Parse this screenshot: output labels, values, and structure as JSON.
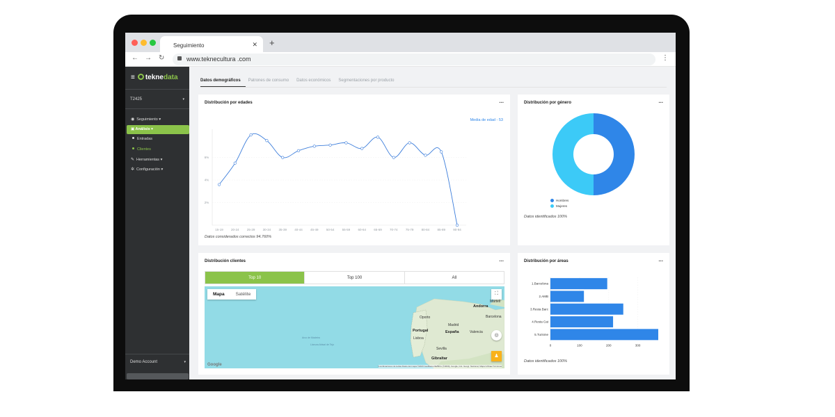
{
  "browser": {
    "tab_title": "Seguimiento",
    "tab_close": "✕",
    "new_tab": "+",
    "url": "www.teknecultura .com"
  },
  "sidebar": {
    "brand_prefix": "tekne",
    "brand_accent": "data",
    "project_select": "T2425",
    "menu": {
      "seguimiento": "Seguimiento ▾",
      "analisis": "Análisis ▾",
      "entradas": "Entradas",
      "clientes": "Clientes",
      "herramientas": "Herramientas ▾",
      "configuracion": "Configuración ▾"
    },
    "account": "Demo Account"
  },
  "tabs": [
    "Datos demográficos",
    "Patrones de consumo",
    "Datos económicos",
    "Segmentaciones por producto"
  ],
  "age_card": {
    "title": "Distribución por edades",
    "menu": "...",
    "average_label": "Media de edad - 53",
    "footnote": "Datos considerados correctos 94.760%"
  },
  "gender_card": {
    "title": "Distribución por género",
    "menu": "...",
    "footnote": "Datos identificados 100%"
  },
  "clients_card": {
    "title": "Distribución clientes",
    "menu": "...",
    "segments": [
      "Top 10",
      "Top 100",
      "All"
    ],
    "map_types": [
      "Mapa",
      "Satélite"
    ],
    "map_labels": {
      "andorra": "Andorra",
      "martell": "Martell",
      "oporto": "Oporto",
      "madrid": "Madrid",
      "barcelona": "Barcelona",
      "portugal": "Portugal",
      "espana": "España",
      "valencia": "Valencia",
      "lisboa": "Lisboa",
      "sevilla": "Sevilla",
      "gibraltar": "Gibraltar",
      "sea1": "Arco de Madeira",
      "sea2": "Llanura Abisal de Tejo"
    },
    "google": "Google",
    "credit": "Combinaciones de teclas   Datos del mapa ©2020 GeoBasis-DE/BKG (©2009), Google, Inst. Geogr. Nacional, Mapa GISrael   Términos"
  },
  "areas_card": {
    "title": "Distribución por áreas",
    "menu": "...",
    "footnote": "Datos identificados 100%"
  },
  "icons": {
    "eye": "eye-icon",
    "building": "building-icon",
    "wrench": "wrench-icon",
    "gear": "gear-icon"
  },
  "colors": {
    "accent_green": "#8bc34a",
    "line_blue": "#3d7edb",
    "bar_blue": "#2f86e8",
    "men_blue": "#2f86e8",
    "women_cyan": "#3ccaf7",
    "sidebar_bg": "#2e3032"
  },
  "chart_data": [
    {
      "type": "line",
      "title": "Distribución por edades",
      "x": [
        "15-19",
        "20-24",
        "25-29",
        "30-34",
        "35-39",
        "40-44",
        "45-49",
        "50-54",
        "55-59",
        "60-64",
        "65-69",
        "70-74",
        "75-79",
        "80-84",
        "85-89",
        "90-94"
      ],
      "series": [
        {
          "values": [
            3.6,
            5.5,
            8.0,
            7.5,
            6.0,
            6.6,
            7.0,
            7.1,
            7.3,
            6.8,
            7.8,
            6.0,
            7.3,
            6.2,
            6.5,
            0.0
          ]
        }
      ],
      "yticks": [
        "2%",
        "4%",
        "6%"
      ],
      "ylim": [
        0,
        8.5
      ],
      "grid": true
    },
    {
      "type": "pie",
      "title": "Distribución por género",
      "categories": [
        "Hombres",
        "Mujeres"
      ],
      "values": [
        50,
        50
      ],
      "donut": true,
      "legend": "bottom"
    },
    {
      "type": "bar",
      "orientation": "horizontal",
      "title": "Distribución por áreas",
      "categories": [
        "1.Barcelona",
        "2.AMB",
        "3.Resta Barc",
        "4.Resta Cat",
        "5.Turisme"
      ],
      "values": [
        195,
        115,
        250,
        215,
        370
      ],
      "xticks": [
        0,
        100,
        200,
        300
      ],
      "xlim": [
        0,
        370
      ]
    }
  ]
}
